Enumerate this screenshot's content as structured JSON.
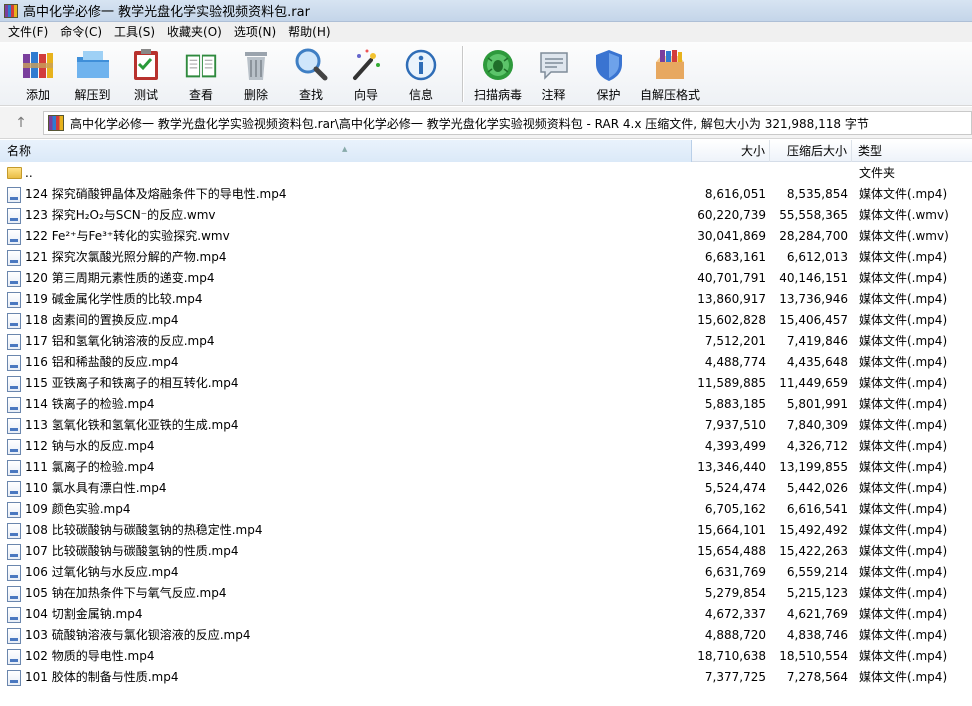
{
  "window": {
    "title": "高中化学必修一 教学光盘化学实验视频资料包.rar"
  },
  "menu": [
    "文件(F)",
    "命令(C)",
    "工具(S)",
    "收藏夹(O)",
    "选项(N)",
    "帮助(H)"
  ],
  "toolbar": {
    "left": [
      {
        "label": "添加",
        "icon": "add-books-icon"
      },
      {
        "label": "解压到",
        "icon": "extract-folder-icon"
      },
      {
        "label": "测试",
        "icon": "test-clipboard-icon"
      },
      {
        "label": "查看",
        "icon": "view-book-icon"
      },
      {
        "label": "删除",
        "icon": "trash-icon"
      },
      {
        "label": "查找",
        "icon": "magnifier-icon"
      },
      {
        "label": "向导",
        "icon": "wizard-wand-icon"
      },
      {
        "label": "信息",
        "icon": "info-icon"
      }
    ],
    "right": [
      {
        "label": "扫描病毒",
        "icon": "virus-scan-icon"
      },
      {
        "label": "注释",
        "icon": "comment-icon"
      },
      {
        "label": "保护",
        "icon": "shield-icon"
      },
      {
        "label": "自解压格式",
        "icon": "sfx-box-icon"
      }
    ]
  },
  "path": {
    "text": "高中化学必修一 教学光盘化学实验视频资料包.rar\\高中化学必修一 教学光盘化学实验视频资料包 - RAR 4.x 压缩文件, 解包大小为 321,988,118 字节"
  },
  "columns": {
    "name": "名称",
    "size": "大小",
    "packed": "压缩后大小",
    "type": "类型"
  },
  "parent_row": {
    "name": "..",
    "type": "文件夹"
  },
  "files": [
    {
      "name": "124 探究硝酸钾晶体及熔融条件下的导电性.mp4",
      "size": "8,616,051",
      "packed": "8,535,854",
      "type": "媒体文件(.mp4)"
    },
    {
      "name": "123 探究H₂O₂与SCN⁻的反应.wmv",
      "size": "60,220,739",
      "packed": "55,558,365",
      "type": "媒体文件(.wmv)"
    },
    {
      "name": "122 Fe²⁺与Fe³⁺转化的实验探究.wmv",
      "size": "30,041,869",
      "packed": "28,284,700",
      "type": "媒体文件(.wmv)"
    },
    {
      "name": "121 探究次氯酸光照分解的产物.mp4",
      "size": "6,683,161",
      "packed": "6,612,013",
      "type": "媒体文件(.mp4)"
    },
    {
      "name": "120 第三周期元素性质的递变.mp4",
      "size": "40,701,791",
      "packed": "40,146,151",
      "type": "媒体文件(.mp4)"
    },
    {
      "name": "119 碱金属化学性质的比较.mp4",
      "size": "13,860,917",
      "packed": "13,736,946",
      "type": "媒体文件(.mp4)"
    },
    {
      "name": "118 卤素间的置换反应.mp4",
      "size": "15,602,828",
      "packed": "15,406,457",
      "type": "媒体文件(.mp4)"
    },
    {
      "name": "117 铝和氢氧化钠溶液的反应.mp4",
      "size": "7,512,201",
      "packed": "7,419,846",
      "type": "媒体文件(.mp4)"
    },
    {
      "name": "116 铝和稀盐酸的反应.mp4",
      "size": "4,488,774",
      "packed": "4,435,648",
      "type": "媒体文件(.mp4)"
    },
    {
      "name": "115 亚铁离子和铁离子的相互转化.mp4",
      "size": "11,589,885",
      "packed": "11,449,659",
      "type": "媒体文件(.mp4)"
    },
    {
      "name": "114 铁离子的检验.mp4",
      "size": "5,883,185",
      "packed": "5,801,991",
      "type": "媒体文件(.mp4)"
    },
    {
      "name": "113 氢氧化铁和氢氧化亚铁的生成.mp4",
      "size": "7,937,510",
      "packed": "7,840,309",
      "type": "媒体文件(.mp4)"
    },
    {
      "name": "112 钠与水的反应.mp4",
      "size": "4,393,499",
      "packed": "4,326,712",
      "type": "媒体文件(.mp4)"
    },
    {
      "name": "111 氯离子的检验.mp4",
      "size": "13,346,440",
      "packed": "13,199,855",
      "type": "媒体文件(.mp4)"
    },
    {
      "name": "110 氯水具有漂白性.mp4",
      "size": "5,524,474",
      "packed": "5,442,026",
      "type": "媒体文件(.mp4)"
    },
    {
      "name": "109 颜色实验.mp4",
      "size": "6,705,162",
      "packed": "6,616,541",
      "type": "媒体文件(.mp4)"
    },
    {
      "name": "108 比较碳酸钠与碳酸氢钠的热稳定性.mp4",
      "size": "15,664,101",
      "packed": "15,492,492",
      "type": "媒体文件(.mp4)"
    },
    {
      "name": "107 比较碳酸钠与碳酸氢钠的性质.mp4",
      "size": "15,654,488",
      "packed": "15,422,263",
      "type": "媒体文件(.mp4)"
    },
    {
      "name": "106 过氧化钠与水反应.mp4",
      "size": "6,631,769",
      "packed": "6,559,214",
      "type": "媒体文件(.mp4)"
    },
    {
      "name": "105 钠在加热条件下与氧气反应.mp4",
      "size": "5,279,854",
      "packed": "5,215,123",
      "type": "媒体文件(.mp4)"
    },
    {
      "name": "104 切割金属钠.mp4",
      "size": "4,672,337",
      "packed": "4,621,769",
      "type": "媒体文件(.mp4)"
    },
    {
      "name": "103 硫酸钠溶液与氯化钡溶液的反应.mp4",
      "size": "4,888,720",
      "packed": "4,838,746",
      "type": "媒体文件(.mp4)"
    },
    {
      "name": "102 物质的导电性.mp4",
      "size": "18,710,638",
      "packed": "18,510,554",
      "type": "媒体文件(.mp4)"
    },
    {
      "name": "101 胶体的制备与性质.mp4",
      "size": "7,377,725",
      "packed": "7,278,564",
      "type": "媒体文件(.mp4)"
    }
  ]
}
